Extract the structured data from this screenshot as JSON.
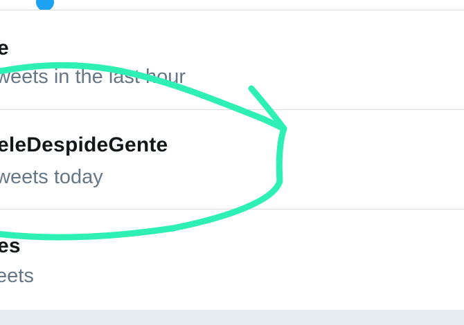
{
  "trends": [
    {
      "name": "e",
      "meta": "weets in the last hour"
    },
    {
      "name": "eleDespideGente",
      "meta": "weets today"
    },
    {
      "name": "es",
      "meta": "eets"
    }
  ],
  "annotation": {
    "stroke_color": "#2ef0b4"
  },
  "colors": {
    "accent": "#1da1f2",
    "meta_text": "#657786",
    "footer_bg": "#e6ecf0"
  }
}
